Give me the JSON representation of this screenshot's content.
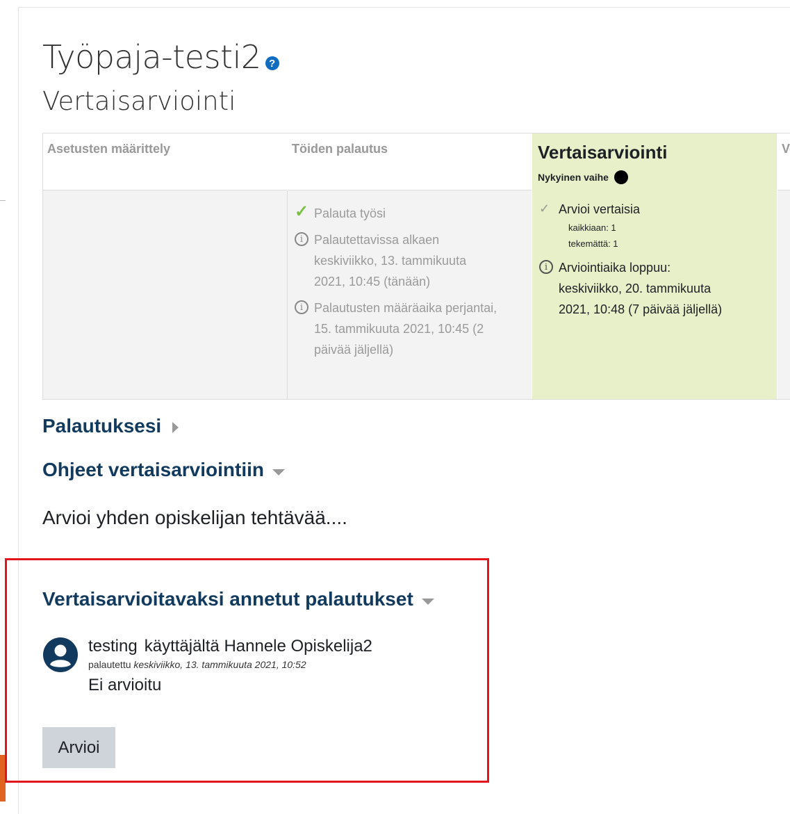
{
  "page": {
    "title": "Työpaja-testi2",
    "subtitle": "Vertaisarviointi"
  },
  "phases": [
    {
      "title": "Asetusten määrittely"
    },
    {
      "title": "Töiden palautus",
      "tasks": [
        {
          "icon": "check-icon",
          "lines": [
            "Palauta työsi"
          ]
        },
        {
          "icon": "info-icon",
          "lines": [
            "Palautettavissa alkaen",
            "keskiviikko, 13. tammikuuta",
            "2021, 10:45 (tänään)"
          ]
        },
        {
          "icon": "info-icon",
          "lines": [
            "Palautusten määräaika perjantai,",
            "15. tammikuuta 2021, 10:45 (2",
            "päivää jäljellä)"
          ]
        }
      ]
    },
    {
      "title": "Vertaisarviointi",
      "current_label": "Nykyinen vaihe",
      "tasks": [
        {
          "icon": "todo-icon",
          "text": "Arvioi vertaisia",
          "details": [
            "kaikkiaan: 1",
            "tekemättä: 1"
          ]
        },
        {
          "icon": "info-icon",
          "lines": [
            "Arviointiaika loppuu:",
            "keskiviikko, 20. tammikuuta",
            "2021, 10:48 (7 päivää jäljellä)"
          ]
        }
      ]
    },
    {
      "title": "Ve"
    }
  ],
  "sections": {
    "submissions": "Palautuksesi",
    "instructions": "Ohjeet vertaisarviointiin",
    "instructions_text": "Arvioi yhden opiskelijan tehtävää....",
    "assigned": "Vertaisarvioitavaksi annetut palautukset"
  },
  "submission": {
    "title": "testing",
    "author": "käyttäjältä Hannele Opiskelija2",
    "submitted_label": "palautettu",
    "submitted_date": "keskiviikko, 13. tammikuuta 2021, 10:52",
    "status": "Ei arvioitu"
  },
  "buttons": {
    "assess": "Arvioi"
  },
  "colors": {
    "current_phase_bg": "#e7f0c9",
    "heading": "#123a5e",
    "highlight_border": "#e3141b",
    "button_bg": "#ced4da",
    "help_icon": "#0f6cbf",
    "check": "#7ac143"
  }
}
